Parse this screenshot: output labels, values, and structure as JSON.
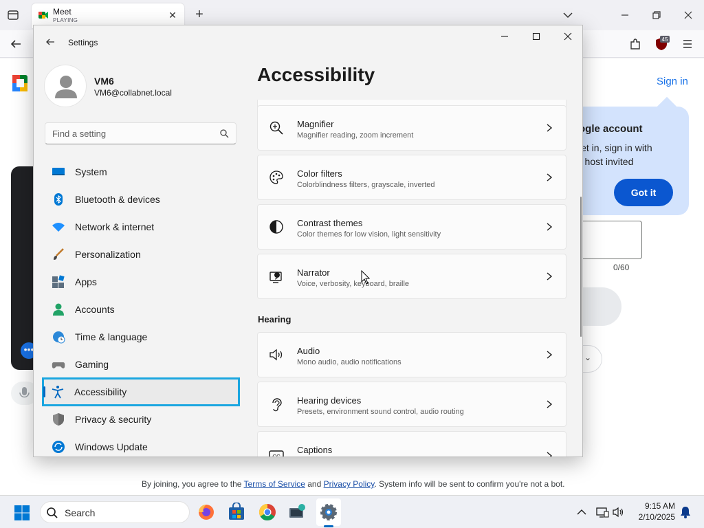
{
  "browser": {
    "tab_title": "Meet",
    "tab_status": "PLAYING",
    "extension_badge": "45"
  },
  "meet_page": {
    "sign_in": "Sign in",
    "tooltip_title": "ogle account",
    "tooltip_line1": "let in, sign in with",
    "tooltip_line2": "r host invited",
    "got_it": "Got it",
    "char_count": "0/60",
    "terms_prefix": "By joining, you agree to the ",
    "terms_link": "Terms of Service",
    "terms_mid": " and ",
    "privacy_link": "Privacy Policy",
    "terms_suffix": ". System info will be sent to confirm you're not a bot."
  },
  "settings": {
    "window_title": "Settings",
    "user": {
      "name": "VM6",
      "email": "VM6@collabnet.local"
    },
    "search_placeholder": "Find a setting",
    "nav": [
      {
        "label": "System",
        "icon": "monitor-icon"
      },
      {
        "label": "Bluetooth & devices",
        "icon": "bluetooth-icon"
      },
      {
        "label": "Network & internet",
        "icon": "wifi-icon"
      },
      {
        "label": "Personalization",
        "icon": "brush-icon"
      },
      {
        "label": "Apps",
        "icon": "apps-icon"
      },
      {
        "label": "Accounts",
        "icon": "person-icon"
      },
      {
        "label": "Time & language",
        "icon": "globe-clock-icon"
      },
      {
        "label": "Gaming",
        "icon": "gamepad-icon"
      },
      {
        "label": "Accessibility",
        "icon": "accessibility-icon",
        "active": true
      },
      {
        "label": "Privacy & security",
        "icon": "shield-icon"
      },
      {
        "label": "Windows Update",
        "icon": "update-icon"
      }
    ],
    "page_title": "Accessibility",
    "vision_cards": [
      {
        "title": "Magnifier",
        "subtitle": "Magnifier reading, zoom increment",
        "icon": "magnifier-icon"
      },
      {
        "title": "Color filters",
        "subtitle": "Colorblindness filters, grayscale, inverted",
        "icon": "palette-icon"
      },
      {
        "title": "Contrast themes",
        "subtitle": "Color themes for low vision, light sensitivity",
        "icon": "contrast-icon"
      },
      {
        "title": "Narrator",
        "subtitle": "Voice, verbosity, keyboard, braille",
        "icon": "narrator-icon"
      }
    ],
    "hearing_label": "Hearing",
    "hearing_cards": [
      {
        "title": "Audio",
        "subtitle": "Mono audio, audio notifications",
        "icon": "speaker-icon"
      },
      {
        "title": "Hearing devices",
        "subtitle": "Presets, environment sound control, audio routing",
        "icon": "ear-icon"
      },
      {
        "title": "Captions",
        "subtitle": "",
        "icon": "captions-icon"
      }
    ]
  },
  "taskbar": {
    "search_label": "Search",
    "time": "9:15 AM",
    "date": "2/10/2025"
  },
  "colors": {
    "accent": "#0067c0",
    "focus_ring": "#1aa6e0",
    "meet_blue": "#0b57d0"
  }
}
